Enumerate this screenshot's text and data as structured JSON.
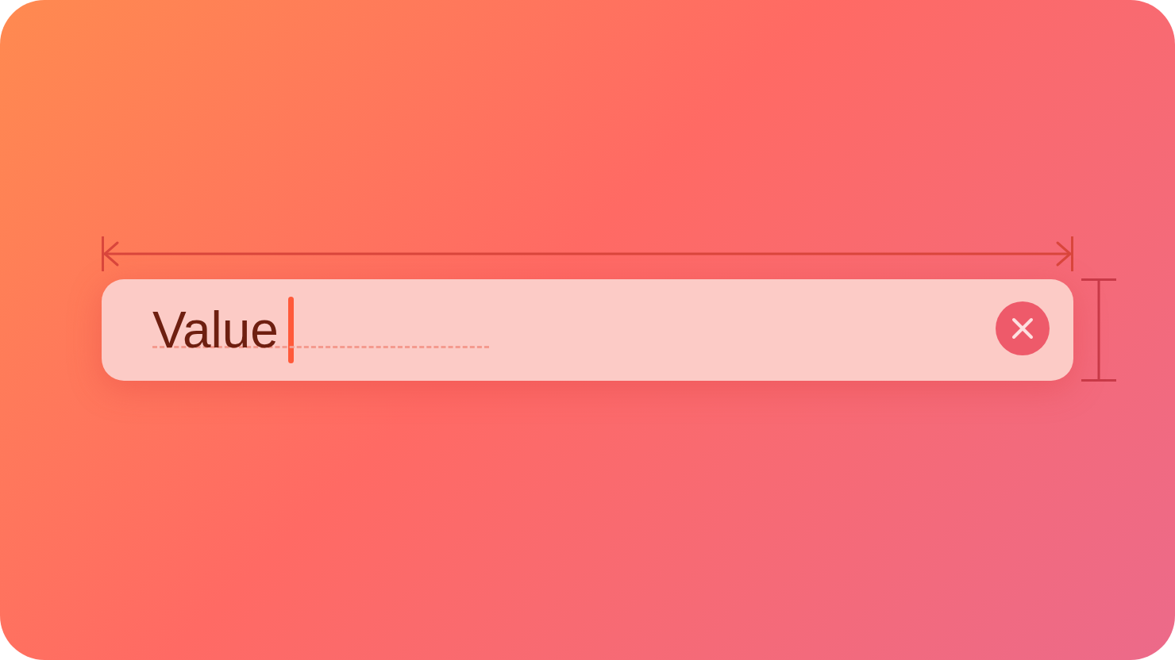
{
  "text_field": {
    "value": "Value",
    "focused": true,
    "clear_button": true
  }
}
